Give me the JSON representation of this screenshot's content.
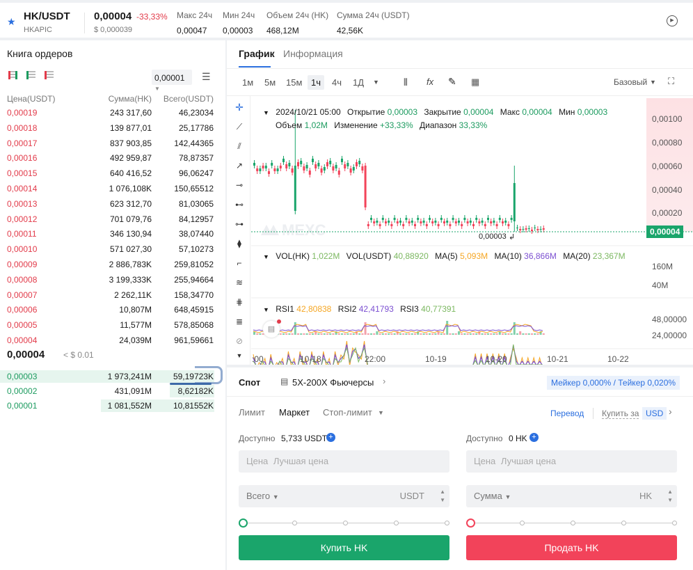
{
  "header": {
    "pair": "HK/USDT",
    "subname": "HKAPIC",
    "price": "0,00004",
    "change": "-33,33%",
    "price_usd": "$ 0,000039",
    "stats": [
      {
        "label": "Макс 24ч",
        "value": "0,00047"
      },
      {
        "label": "Мин 24ч",
        "value": "0,00003"
      },
      {
        "label": "Объем 24ч (HK)",
        "value": "468,12M"
      },
      {
        "label": "Сумма 24ч (USDT)",
        "value": "42,56K"
      }
    ]
  },
  "orderbook": {
    "title": "Книга ордеров",
    "precision": "0,00001",
    "columns": [
      "Цена(USDT)",
      "Сумма(HK)",
      "Всего(USDT)"
    ],
    "asks": [
      [
        "0,00019",
        "243 317,60",
        "46,23034"
      ],
      [
        "0,00018",
        "139 877,01",
        "25,17786"
      ],
      [
        "0,00017",
        "837 903,85",
        "142,44365"
      ],
      [
        "0,00016",
        "492 959,87",
        "78,87357"
      ],
      [
        "0,00015",
        "640 416,52",
        "96,06247"
      ],
      [
        "0,00014",
        "1 076,108K",
        "150,65512"
      ],
      [
        "0,00013",
        "623 312,70",
        "81,03065"
      ],
      [
        "0,00012",
        "701 079,76",
        "84,12957"
      ],
      [
        "0,00011",
        "346 130,94",
        "38,07440"
      ],
      [
        "0,00010",
        "571 027,30",
        "57,10273"
      ],
      [
        "0,00009",
        "2 886,783K",
        "259,81052"
      ],
      [
        "0,00008",
        "3 199,333K",
        "255,94664"
      ],
      [
        "0,00007",
        "2 262,11K",
        "158,34770"
      ],
      [
        "0,00006",
        "10,807M",
        "648,45915"
      ],
      [
        "0,00005",
        "11,577M",
        "578,85068"
      ],
      [
        "0,00004",
        "24,039M",
        "961,59661"
      ]
    ],
    "last_price": "0,00004",
    "last_usd": "< $ 0.01",
    "bids": [
      [
        "0,00003",
        "1 973,241M",
        "59,19723K"
      ],
      [
        "0,00002",
        "431,091M",
        "8,62182K"
      ],
      [
        "0,00001",
        "1 081,552M",
        "10,81552K"
      ]
    ]
  },
  "chart": {
    "tabs": [
      "График",
      "Информация"
    ],
    "timeframes": [
      "1м",
      "5м",
      "15м",
      "1ч",
      "4ч",
      "1Д"
    ],
    "active_tf": "1ч",
    "view_mode": "Базовый",
    "ohlc": {
      "date": "2024/10/21 05:00",
      "open_label": "Открытие",
      "open": "0,00003",
      "close_label": "Закрытие",
      "close": "0,00004",
      "high_label": "Макс",
      "high": "0,00004",
      "low_label": "Мин",
      "low": "0,00003",
      "vol_label": "Объем",
      "vol": "1,02M",
      "chg_label": "Изменение",
      "chg": "+33,33%",
      "range_label": "Диапазон",
      "range": "33,33%"
    },
    "price_axis": [
      "0,00100",
      "0,00080",
      "0,00060",
      "0,00040",
      "0,00020"
    ],
    "current_price": "0,00004",
    "low_marker": "0,00003",
    "watermark": "MEXC",
    "vol": {
      "l1": "VOL(HK)",
      "v1": "1,022M",
      "l2": "VOL(USDT)",
      "v2": "40,88920",
      "l3": "MA(5)",
      "v3": "5,093M",
      "l4": "MA(10)",
      "v4": "36,866M",
      "l5": "MA(20)",
      "v5": "23,367M",
      "axis": [
        "160M",
        "40M"
      ]
    },
    "rsi": {
      "l1": "RSI1",
      "v1": "42,80838",
      "l2": "RSI2",
      "v2": "42,41793",
      "l3": "RSI3",
      "v3": "40,77391",
      "axis": [
        "48,00000",
        "24,00000"
      ]
    },
    "time_axis": [
      ":00",
      "10-18",
      "22:00",
      "10-19",
      "10-20",
      "10-21",
      "10-22"
    ]
  },
  "trade": {
    "spot": "Спот",
    "futures": "5X-200X Фьючерсы",
    "fees": "Мейкер 0,000% / Тейкер 0,020%",
    "order_types": [
      "Лимит",
      "Маркет",
      "Стоп-лимит"
    ],
    "transfer": "Перевод",
    "buy_for": "Купить за",
    "currency": "USD",
    "available_label": "Доступно",
    "buy_available": "5,733 USDT",
    "sell_available": "0 HK",
    "price_label": "Цена",
    "best_price": "Лучшая цена",
    "total_label": "Всего",
    "amount_label": "Сумма",
    "buy_unit": "USDT",
    "sell_unit": "HK",
    "buy_button": "Купить HK",
    "sell_button": "Продать HK",
    "colors": {
      "buy": "#1aa56b",
      "sell": "#f2435a",
      "accent": "#2b6fdf"
    }
  }
}
